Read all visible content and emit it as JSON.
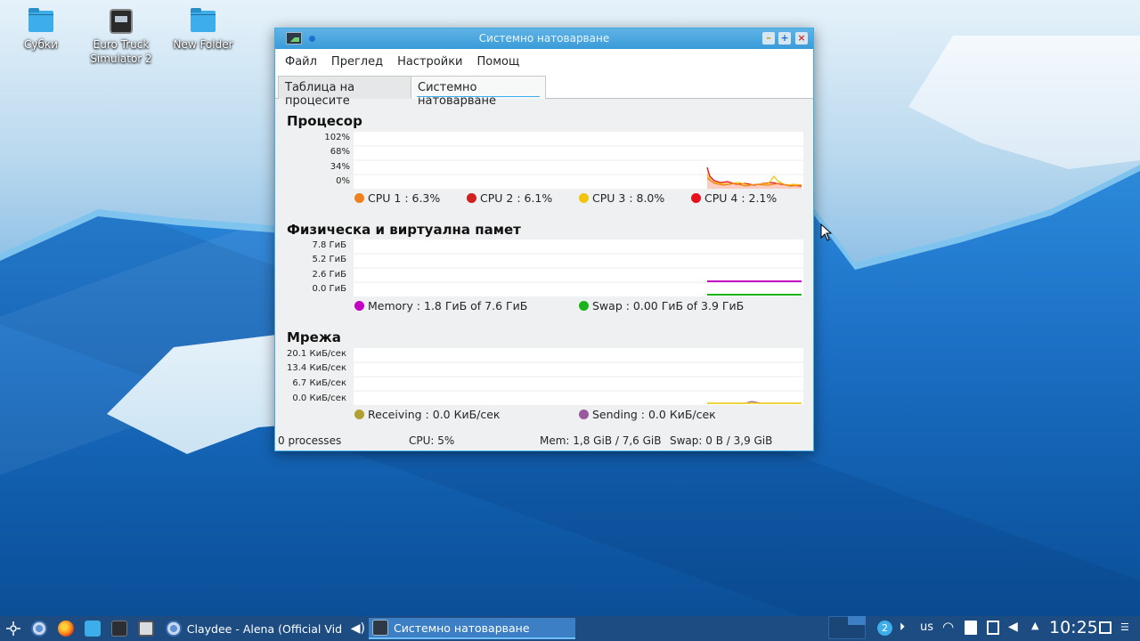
{
  "desktop": {
    "icons": [
      {
        "label": "Субки"
      },
      {
        "label": "Euro Truck Simulator 2"
      },
      {
        "label": "New Folder"
      }
    ]
  },
  "window": {
    "title": "Системно натоварване",
    "menu": [
      "Файл",
      "Преглед",
      "Настройки",
      "Помощ"
    ],
    "tabs": [
      "Таблица на процесите",
      "Системно натоварване"
    ],
    "cpu": {
      "title": "Процесор",
      "y_labels": [
        "102%",
        "68%",
        "34%",
        "0%"
      ],
      "legend": [
        {
          "label": "CPU 1 : 6.3%",
          "color": "#f0821e"
        },
        {
          "label": "CPU 2 : 6.1%",
          "color": "#d22020"
        },
        {
          "label": "CPU 3 : 8.0%",
          "color": "#f2c40c"
        },
        {
          "label": "CPU 4 : 2.1%",
          "color": "#e8101a"
        }
      ]
    },
    "memory": {
      "title": "Физическа и виртуална памет",
      "y_labels": [
        "7.8 ГиБ",
        "5.2 ГиБ",
        "2.6 ГиБ",
        "0.0 ГиБ"
      ],
      "legend": [
        {
          "label": "Memory : 1.8 ГиБ of 7.6 ГиБ",
          "color": "#c400c4"
        },
        {
          "label": "Swap : 0.00 ГиБ of 3.9 ГиБ",
          "color": "#19b419"
        }
      ]
    },
    "network": {
      "title": "Мрежа",
      "y_labels": [
        "20.1 КиБ/сек",
        "13.4 КиБ/сек",
        "6.7 КиБ/сек",
        "0.0 КиБ/сек"
      ],
      "legend": [
        {
          "label": "Receiving : 0.0 КиБ/сек",
          "color": "#b0a030"
        },
        {
          "label": "Sending : 0.0 КиБ/сек",
          "color": "#9a58a0"
        }
      ]
    },
    "status": {
      "processes": "0 processes",
      "cpu": "CPU: 5%",
      "mem": "Mem: 1,8 GiB / 7,6 GiB",
      "swap": "Swap: 0 B / 3,9 GiB"
    }
  },
  "taskbar": {
    "tasks": [
      {
        "label": "Claydee - Alena (Official Vide..."
      },
      {
        "label": "Системно натоварване"
      }
    ],
    "tray": {
      "desktop_number": "2",
      "keyboard_layout": "us",
      "clock": "10:25"
    }
  }
}
